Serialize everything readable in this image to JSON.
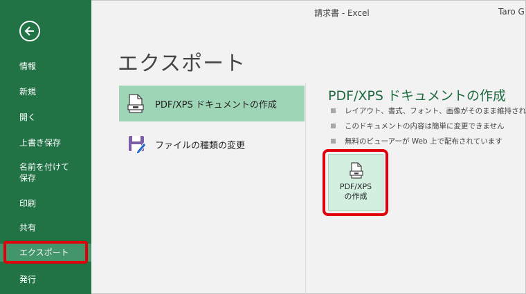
{
  "window": {
    "title": "請求書 - Excel",
    "user": "Taro G"
  },
  "sidebar": {
    "items": [
      {
        "label": "情報"
      },
      {
        "label": "新規"
      },
      {
        "label": "開く"
      },
      {
        "label": "上書き保存"
      },
      {
        "label": "名前を付けて"
      },
      {
        "label": "保存"
      },
      {
        "label": "印刷"
      },
      {
        "label": "共有"
      },
      {
        "label": "エクスポート"
      },
      {
        "label": "発行"
      }
    ]
  },
  "page": {
    "heading": "エクスポート"
  },
  "options": [
    {
      "label": "PDF/XPS ドキュメントの作成",
      "selected": true
    },
    {
      "label": "ファイルの種類の変更",
      "selected": false
    }
  ],
  "panel": {
    "title": "PDF/XPS ドキュメントの作成",
    "bullets": [
      "レイアウト、書式、フォント、画像がそのまま維持されます",
      "このドキュメントの内容は簡単に変更できません",
      "無料のビューアーが Web 上で配布されています"
    ],
    "button": {
      "line1": "PDF/XPS",
      "line2": "の作成"
    }
  },
  "colors": {
    "sidebar": "#217346",
    "selected_option": "#9fd5b7",
    "highlight": "#e0000b",
    "title_green": "#1e6b3f"
  }
}
